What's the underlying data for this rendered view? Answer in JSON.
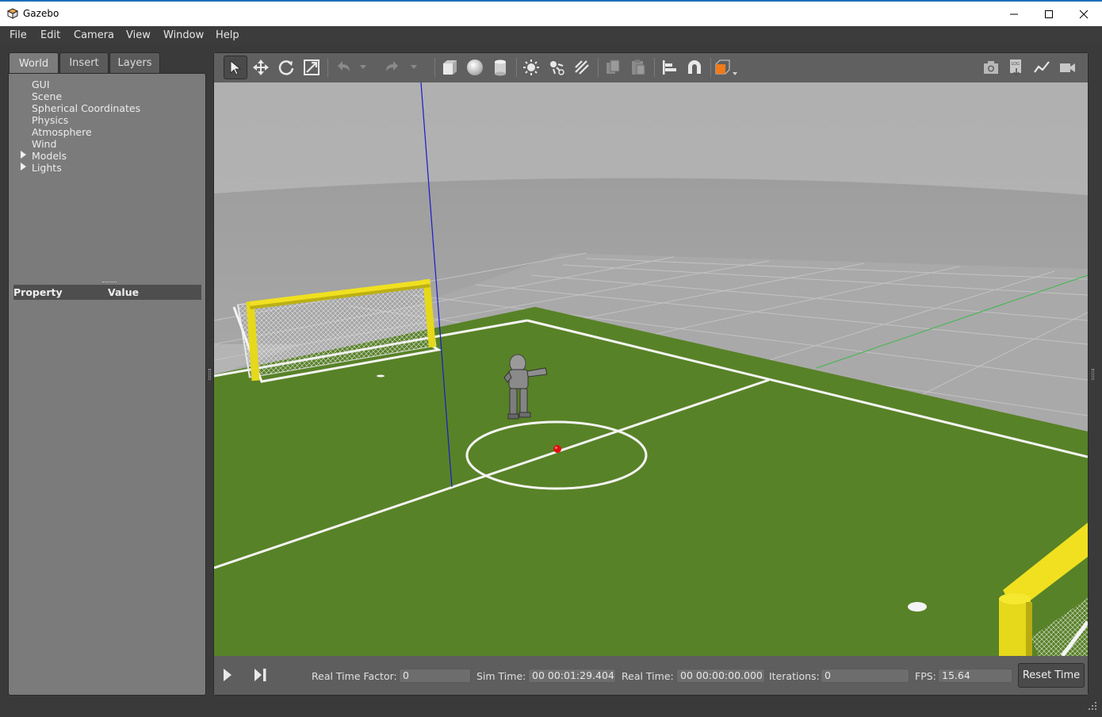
{
  "window": {
    "title": "Gazebo"
  },
  "menu": [
    "File",
    "Edit",
    "Camera",
    "View",
    "Window",
    "Help"
  ],
  "left_panel": {
    "tabs": [
      "World",
      "Insert",
      "Layers"
    ],
    "active_tab": "World",
    "tree": [
      {
        "label": "GUI",
        "expandable": false
      },
      {
        "label": "Scene",
        "expandable": false
      },
      {
        "label": "Spherical Coordinates",
        "expandable": false
      },
      {
        "label": "Physics",
        "expandable": false
      },
      {
        "label": "Atmosphere",
        "expandable": false
      },
      {
        "label": "Wind",
        "expandable": false
      },
      {
        "label": "Models",
        "expandable": true
      },
      {
        "label": "Lights",
        "expandable": true
      }
    ],
    "property_header": {
      "property": "Property",
      "value": "Value"
    }
  },
  "toolbar": {
    "tools": [
      "select-mode",
      "translate-mode",
      "rotate-mode",
      "scale-mode",
      "undo",
      "redo",
      "box-shape",
      "sphere-shape",
      "cylinder-shape",
      "point-light",
      "spot-light",
      "directional-light",
      "copy",
      "paste",
      "align",
      "snap",
      "view-angle"
    ],
    "selected": "select-mode",
    "right_tools": [
      "screenshot",
      "log",
      "plot",
      "video-record"
    ]
  },
  "bottom_bar": {
    "real_time_factor_label": "Real Time Factor:",
    "real_time_factor": "0",
    "sim_time_label": "Sim Time:",
    "sim_time": "00 00:01:29.404",
    "real_time_label": "Real Time:",
    "real_time": "00 00:00:00.000",
    "iterations_label": "Iterations:",
    "iterations": "0",
    "fps_label": "FPS:",
    "fps": "15.64",
    "reset_label": "Reset Time"
  },
  "colors": {
    "accent_orange": "#f07a1a",
    "field_green": "#5b8428",
    "goal_yellow": "#f0e020"
  }
}
